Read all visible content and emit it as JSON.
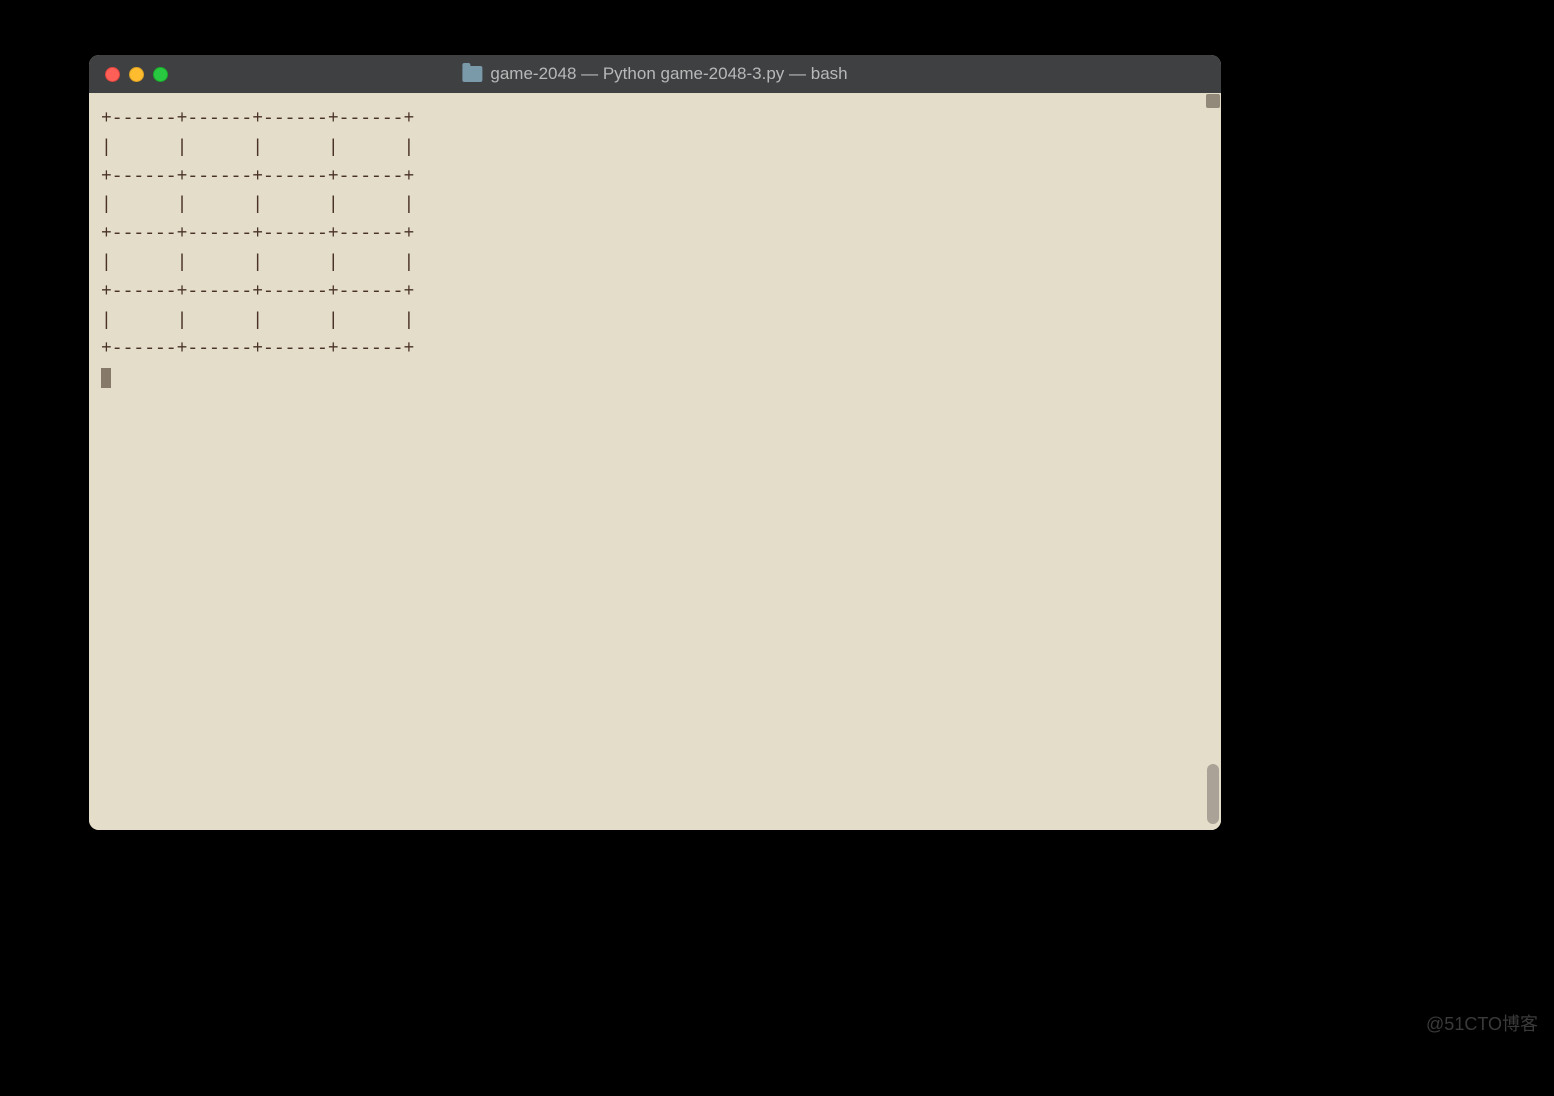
{
  "window": {
    "title": "game-2048 — Python game-2048-3.py — bash"
  },
  "terminal": {
    "lines": [
      "+------+------+------+------+",
      "|      |      |      |      |",
      "+------+------+------+------+",
      "|      |      |      |      |",
      "+------+------+------+------+",
      "|      |      |      |      |",
      "+------+------+------+------+",
      "|      |      |      |      |",
      "+------+------+------+------+"
    ]
  },
  "watermark": "@51CTO博客"
}
